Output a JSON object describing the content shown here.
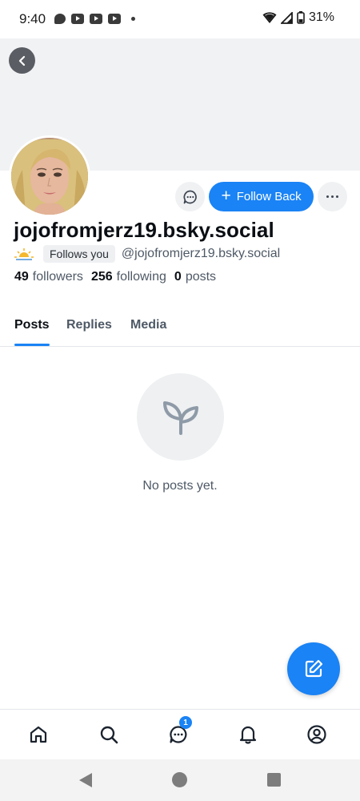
{
  "status_bar": {
    "time": "9:40",
    "battery": "31%",
    "notification_icons": [
      "chat-bubble-icon",
      "youtube-icon",
      "youtube-icon",
      "youtube-icon",
      "dot-icon"
    ],
    "system_icons": [
      "wifi-icon",
      "signal-icon",
      "battery-icon"
    ]
  },
  "profile": {
    "display_name": "jojofromjerz19.bsky.social",
    "follows_you_label": "Follows you",
    "handle": "@jojofromjerz19.bsky.social",
    "stats": {
      "followers_count": "49",
      "followers_label": "followers",
      "following_count": "256",
      "following_label": "following",
      "posts_count": "0",
      "posts_label": "posts"
    }
  },
  "actions": {
    "follow_back_label": "Follow Back"
  },
  "tabs": [
    {
      "label": "Posts",
      "active": true
    },
    {
      "label": "Replies",
      "active": false
    },
    {
      "label": "Media",
      "active": false
    }
  ],
  "empty_state": {
    "message": "No posts yet."
  },
  "bottom_nav": {
    "items": [
      "home-icon",
      "search-icon",
      "chat-icon",
      "bell-icon",
      "profile-icon"
    ],
    "chat_badge": "1"
  },
  "colors": {
    "accent": "#1a83f5",
    "banner": "#f1f2f4",
    "muted_text": "#4e5966"
  }
}
